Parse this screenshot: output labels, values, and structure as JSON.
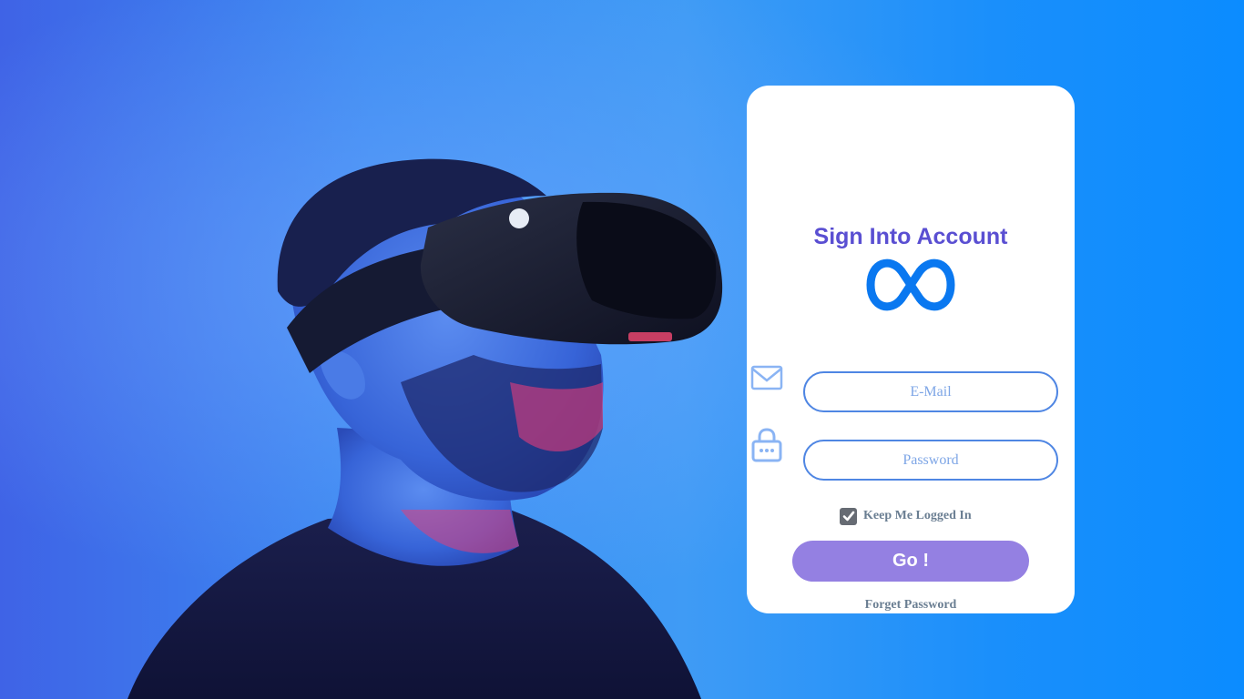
{
  "login": {
    "title": "Sign Into Account",
    "logo_icon": "meta-infinity-logo-icon",
    "email": {
      "icon": "envelope-icon",
      "placeholder": "E-Mail",
      "value": ""
    },
    "password": {
      "icon": "lock-icon",
      "placeholder": "Password",
      "value": ""
    },
    "remember": {
      "label": "Keep Me Logged In",
      "checked": true
    },
    "submit_label": "Go !",
    "forgot_label": "Forget Password"
  },
  "colors": {
    "accent": "#5a4fd2",
    "button": "#9480e2",
    "input_border": "#4f86e3",
    "logo": "#0a78f0",
    "icon": "#8ab4f4",
    "link": "#6a7e92"
  }
}
